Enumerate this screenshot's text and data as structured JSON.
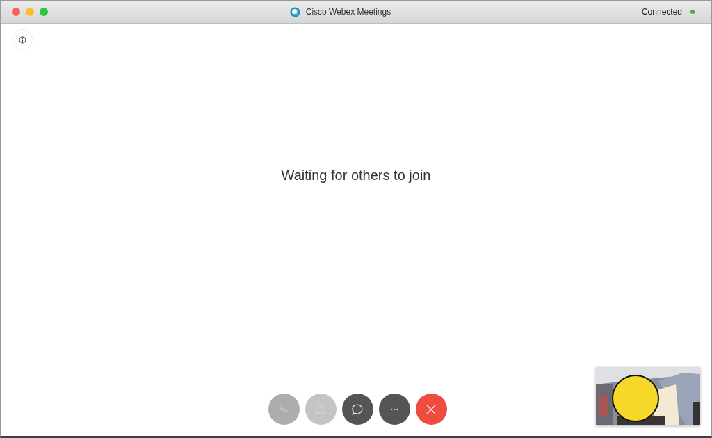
{
  "window": {
    "title": "Cisco Webex Meetings",
    "connection": {
      "label": "Connected",
      "color": "#3cb44a"
    }
  },
  "main": {
    "message": "Waiting for others to join"
  },
  "controls": [
    {
      "kind": "phone",
      "disabled": true
    },
    {
      "kind": "share",
      "disabled": true
    },
    {
      "kind": "chat",
      "disabled": false
    },
    {
      "kind": "more",
      "disabled": false
    },
    {
      "kind": "end",
      "disabled": false
    }
  ]
}
